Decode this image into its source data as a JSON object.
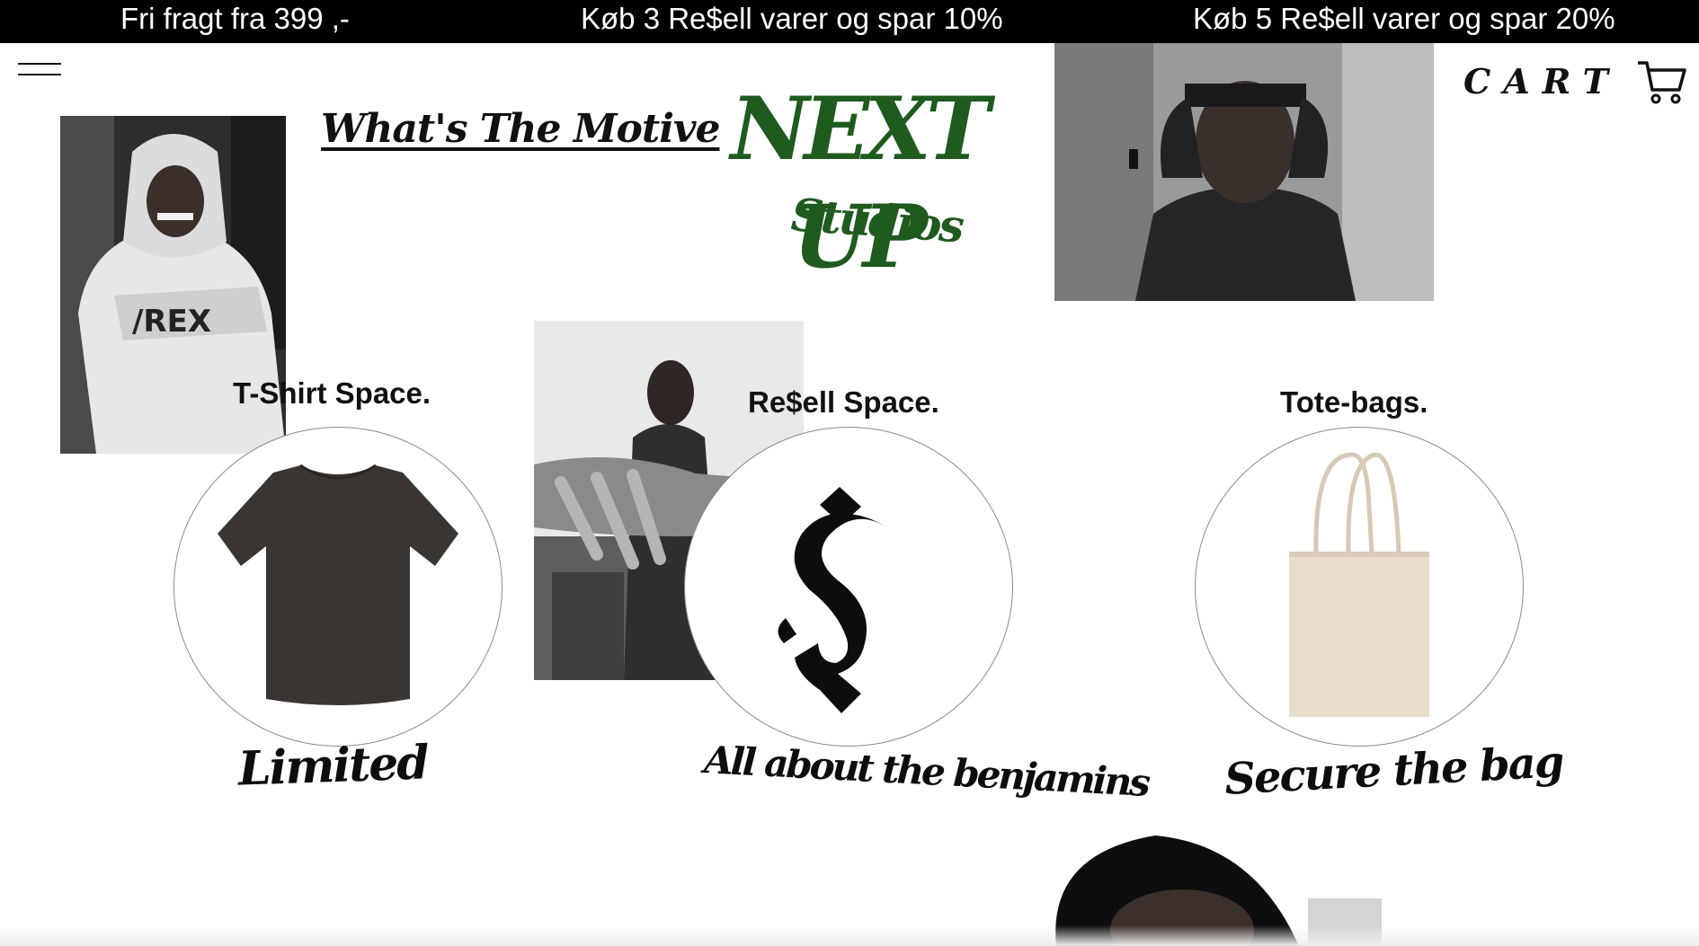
{
  "promo": {
    "item1": "Fri fragt fra 399 ,-",
    "item2": "Køb 3 Re$ell varer og spar 10%",
    "item3": "Køb 5 Re$ell varer og spar 20%"
  },
  "header": {
    "motive_link": "What's The Motive",
    "brand_main": "NEXT UP",
    "brand_sub": "Studios",
    "cart_label": "CART"
  },
  "sections": {
    "tshirt": {
      "label": "T-Shirt Space.",
      "tagline": "Limited"
    },
    "resell": {
      "label": "Re$ell Space.",
      "tagline": "All about the benjamins"
    },
    "totes": {
      "label": "Tote-bags.",
      "tagline": "Secure the bag"
    }
  },
  "colors": {
    "brand_green": "#1f5a1f",
    "promo_bg": "#000000",
    "shirt": "#3a3432",
    "tote": "#e8dccb"
  },
  "icons": [
    "menu-icon",
    "cart-icon",
    "gothic-s-icon"
  ]
}
